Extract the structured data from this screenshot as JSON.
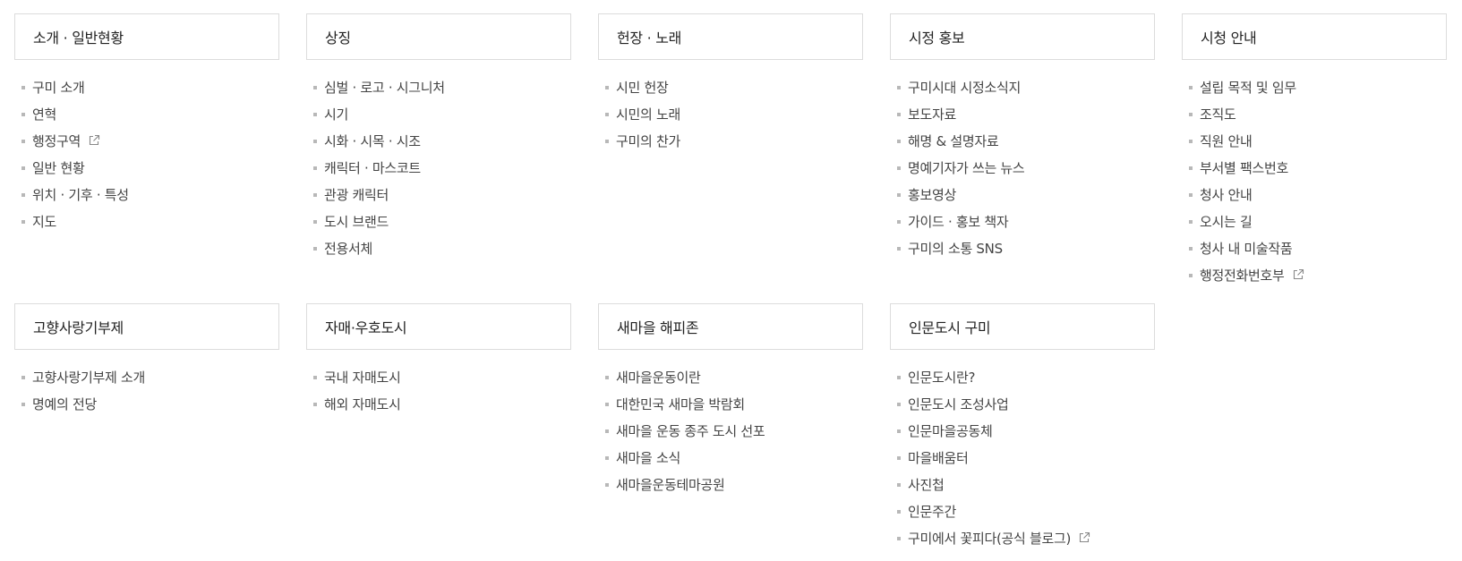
{
  "sections": [
    {
      "title": "소개 · 일반현황",
      "items": [
        {
          "label": "구미 소개",
          "external": false
        },
        {
          "label": "연혁",
          "external": false
        },
        {
          "label": "행정구역",
          "external": true
        },
        {
          "label": "일반 현황",
          "external": false
        },
        {
          "label": "위치 · 기후 · 특성",
          "external": false
        },
        {
          "label": "지도",
          "external": false
        }
      ]
    },
    {
      "title": "상징",
      "items": [
        {
          "label": "심벌 · 로고 · 시그니처",
          "external": false
        },
        {
          "label": "시기",
          "external": false
        },
        {
          "label": "시화 · 시목 · 시조",
          "external": false
        },
        {
          "label": "캐릭터 · 마스코트",
          "external": false
        },
        {
          "label": "관광 캐릭터",
          "external": false
        },
        {
          "label": "도시 브랜드",
          "external": false
        },
        {
          "label": "전용서체",
          "external": false
        }
      ]
    },
    {
      "title": "헌장 · 노래",
      "items": [
        {
          "label": "시민 헌장",
          "external": false
        },
        {
          "label": "시민의 노래",
          "external": false
        },
        {
          "label": "구미의 찬가",
          "external": false
        }
      ]
    },
    {
      "title": "시정 홍보",
      "items": [
        {
          "label": "구미시대 시정소식지",
          "external": false
        },
        {
          "label": "보도자료",
          "external": false
        },
        {
          "label": "해명 & 설명자료",
          "external": false
        },
        {
          "label": "명예기자가 쓰는 뉴스",
          "external": false
        },
        {
          "label": "홍보영상",
          "external": false
        },
        {
          "label": "가이드 · 홍보 책자",
          "external": false
        },
        {
          "label": "구미의 소통 SNS",
          "external": false
        }
      ]
    },
    {
      "title": "시청 안내",
      "items": [
        {
          "label": "설립 목적 및 임무",
          "external": false
        },
        {
          "label": "조직도",
          "external": false
        },
        {
          "label": "직원 안내",
          "external": false
        },
        {
          "label": "부서별 팩스번호",
          "external": false
        },
        {
          "label": "청사 안내",
          "external": false
        },
        {
          "label": "오시는 길",
          "external": false
        },
        {
          "label": "청사 내 미술작품",
          "external": false
        },
        {
          "label": "행정전화번호부",
          "external": true
        }
      ]
    },
    {
      "title": "고향사랑기부제",
      "items": [
        {
          "label": "고향사랑기부제 소개",
          "external": false
        },
        {
          "label": "명예의 전당",
          "external": false
        }
      ]
    },
    {
      "title": "자매·우호도시",
      "items": [
        {
          "label": "국내 자매도시",
          "external": false
        },
        {
          "label": "해외 자매도시",
          "external": false
        }
      ]
    },
    {
      "title": "새마을 해피존",
      "items": [
        {
          "label": "새마을운동이란",
          "external": false
        },
        {
          "label": "대한민국 새마을 박람회",
          "external": false
        },
        {
          "label": "새마을 운동 종주 도시 선포",
          "external": false
        },
        {
          "label": "새마을 소식",
          "external": false
        },
        {
          "label": "새마을운동테마공원",
          "external": false
        }
      ]
    },
    {
      "title": "인문도시 구미",
      "items": [
        {
          "label": "인문도시란?",
          "external": false
        },
        {
          "label": "인문도시 조성사업",
          "external": false
        },
        {
          "label": "인문마을공동체",
          "external": false
        },
        {
          "label": "마을배움터",
          "external": false
        },
        {
          "label": "사진첩",
          "external": false
        },
        {
          "label": "인문주간",
          "external": false
        },
        {
          "label": "구미에서 꽃피다(공식 블로그)",
          "external": true
        }
      ]
    }
  ],
  "icons": {
    "external_link": "external-link-icon",
    "bullet": "square-bullet-icon"
  },
  "colors": {
    "border": "#dcdcdc",
    "bullet": "#b8b8b8",
    "text": "#444444",
    "heading": "#222222"
  }
}
